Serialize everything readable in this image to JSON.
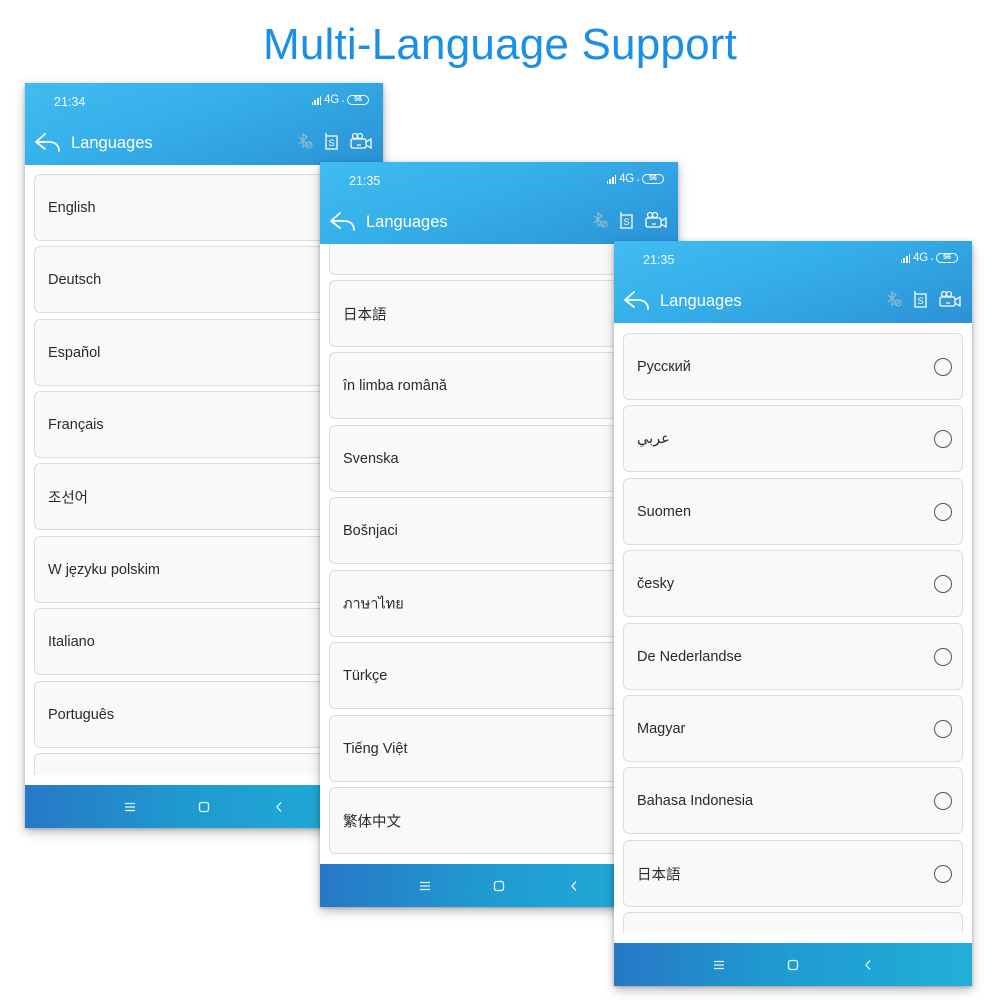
{
  "headline": "Multi-Language Support",
  "colors": {
    "headline": "#1a8fe8",
    "appbar_start": "#41bcf0",
    "appbar_end": "#2a92d6",
    "navbar_start": "#2778c6",
    "navbar_end": "#21afd8"
  },
  "screens": [
    {
      "status": {
        "time": "21:34",
        "network": "4G",
        "battery": "56"
      },
      "appbar": {
        "title": "Languages",
        "back_icon": "reply-arrow-icon",
        "icons": [
          "bluetooth-off-icon",
          "s-box-icon",
          "video-camera-icon"
        ]
      },
      "items": [
        {
          "label": "English"
        },
        {
          "label": "Deutsch"
        },
        {
          "label": "Español"
        },
        {
          "label": "Français"
        },
        {
          "label": "조선어"
        },
        {
          "label": "W języku polskim"
        },
        {
          "label": "Italiano"
        },
        {
          "label": "Português"
        },
        {
          "label": ""
        }
      ],
      "navbar": [
        "menu-icon",
        "home-icon",
        "back-icon"
      ]
    },
    {
      "status": {
        "time": "21:35",
        "network": "4G",
        "battery": "56"
      },
      "appbar": {
        "title": "Languages",
        "back_icon": "reply-arrow-icon",
        "icons": [
          "bluetooth-off-icon",
          "s-box-icon",
          "video-camera-icon"
        ]
      },
      "items": [
        {
          "label": ""
        },
        {
          "label": "日本語"
        },
        {
          "label": "în limba română"
        },
        {
          "label": "Svenska"
        },
        {
          "label": "Bošnjaci"
        },
        {
          "label": "ภาษาไทย"
        },
        {
          "label": "Türkçe"
        },
        {
          "label": "Tiếng Việt"
        },
        {
          "label": "繁体中文"
        }
      ],
      "navbar": [
        "menu-icon",
        "home-icon",
        "back-icon"
      ]
    },
    {
      "status": {
        "time": "21:35",
        "network": "4G",
        "battery": "56"
      },
      "appbar": {
        "title": "Languages",
        "back_icon": "reply-arrow-icon",
        "icons": [
          "bluetooth-off-icon",
          "s-box-icon",
          "video-camera-icon"
        ]
      },
      "items": [
        {
          "label": "Русский",
          "selected": false
        },
        {
          "label": "عربي",
          "selected": false
        },
        {
          "label": "Suomen",
          "selected": false
        },
        {
          "label": "česky",
          "selected": false
        },
        {
          "label": "De Nederlandse",
          "selected": false
        },
        {
          "label": "Magyar",
          "selected": false
        },
        {
          "label": "Bahasa Indonesia",
          "selected": false
        },
        {
          "label": "日本語",
          "selected": false
        },
        {
          "label": "",
          "selected": false
        }
      ],
      "navbar": [
        "menu-icon",
        "home-icon",
        "back-icon"
      ]
    }
  ]
}
